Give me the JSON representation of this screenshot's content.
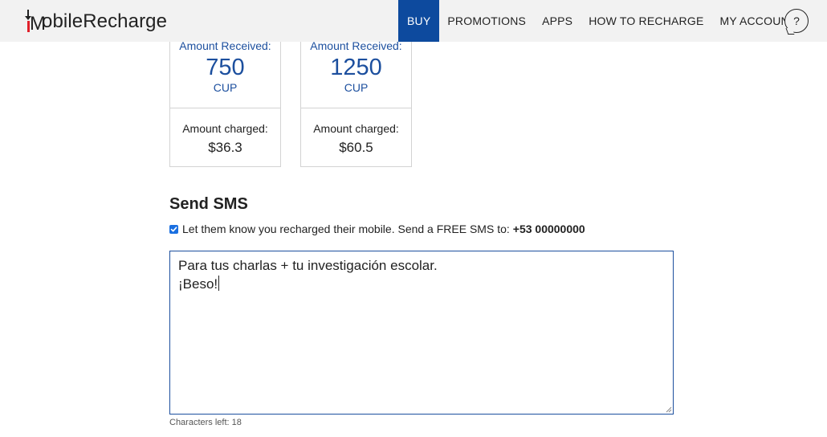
{
  "header": {
    "logo_text": "obileRecharge",
    "logo_letter": "M",
    "nav": [
      {
        "label": "BUY",
        "active": true
      },
      {
        "label": "PROMOTIONS",
        "active": false
      },
      {
        "label": "APPS",
        "active": false
      },
      {
        "label": "HOW TO RECHARGE",
        "active": false
      },
      {
        "label": "MY ACCOUNT",
        "active": false
      }
    ],
    "help_label": "?"
  },
  "cards": [
    {
      "received_label": "Amount Received:",
      "received_value": "750",
      "received_unit": "CUP",
      "charged_label": "Amount charged:",
      "charged_value": "$36.3"
    },
    {
      "received_label": "Amount Received:",
      "received_value": "1250",
      "received_unit": "CUP",
      "charged_label": "Amount charged:",
      "charged_value": "$60.5"
    }
  ],
  "sms": {
    "title": "Send SMS",
    "checkbox_checked": true,
    "checkbox_label": "Let them know you recharged their mobile. Send a FREE SMS to:",
    "phone_number": "+53 00000000",
    "message_line1": "Para tus charlas + tu investigación escolar.",
    "message_line2": "¡Beso!",
    "chars_left_label": "Characters left:",
    "chars_left_value": "18"
  },
  "colors": {
    "brand_blue": "#0d4a9e",
    "accent_red": "#e0202a",
    "checkbox_blue": "#1a6fe0"
  }
}
